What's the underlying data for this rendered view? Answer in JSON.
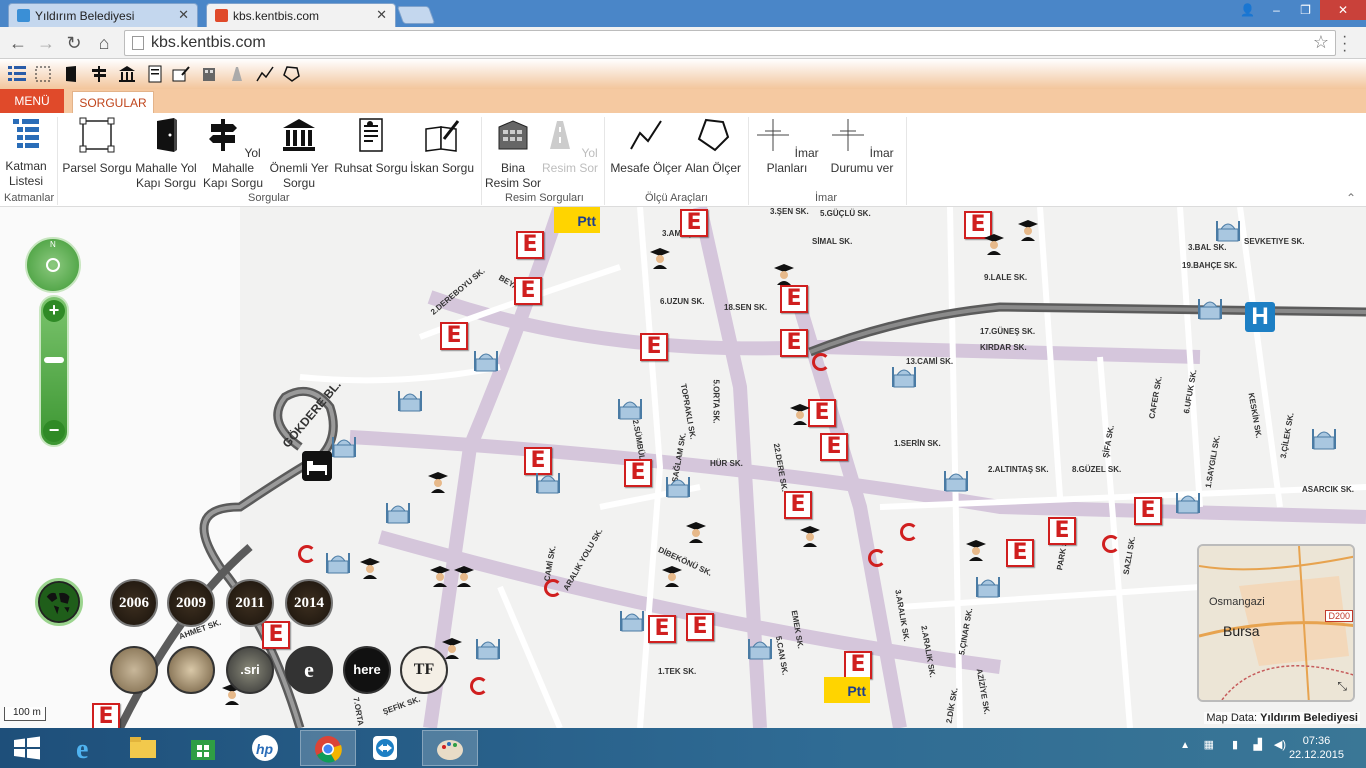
{
  "browser": {
    "tabs": [
      {
        "title": "Yıldırım Belediyesi",
        "active": false
      },
      {
        "title": "kbs.kentbis.com",
        "active": true
      }
    ],
    "url": "kbs.kentbis.com"
  },
  "menubar": {
    "menu_label": "MENÜ",
    "active_tab": "SORGULAR"
  },
  "ribbon": {
    "groups": [
      {
        "label": "Katmanlar",
        "buttons": [
          {
            "label": "Katman Listesi",
            "icon": "layers-list-icon",
            "enabled": true
          }
        ]
      },
      {
        "label": "Sorgular",
        "buttons": [
          {
            "label": "Parsel Sorgu",
            "icon": "parcel-icon",
            "enabled": true
          },
          {
            "label": "Mahalle Yol Kapı Sorgu",
            "icon": "door-icon",
            "enabled": true
          },
          {
            "label": "Yol Mahalle Kapı Sorgu",
            "icon": "signpost-icon",
            "enabled": true
          },
          {
            "label": "Önemli Yer Sorgu",
            "icon": "landmark-icon",
            "enabled": true
          },
          {
            "label": "Ruhsat Sorgu",
            "icon": "license-doc-icon",
            "enabled": true
          },
          {
            "label": "İskan Sorgu",
            "icon": "book-pen-icon",
            "enabled": true
          }
        ]
      },
      {
        "label": "Resim Sorguları",
        "buttons": [
          {
            "label": "Bina Resim Sor",
            "icon": "building-photo-icon",
            "enabled": true
          },
          {
            "label": "Yol Resim Sor",
            "icon": "road-photo-icon",
            "enabled": false
          }
        ]
      },
      {
        "label": "Ölçü Araçları",
        "buttons": [
          {
            "label": "Mesafe Ölçer",
            "icon": "distance-measure-icon",
            "enabled": true
          },
          {
            "label": "Alan Ölçer",
            "icon": "area-measure-icon",
            "enabled": true
          }
        ]
      },
      {
        "label": "İmar",
        "buttons": [
          {
            "label": "İmar Planları",
            "icon": "zoning-plan-icon",
            "enabled": true
          },
          {
            "label": "İmar Durumu ver",
            "icon": "zoning-status-icon",
            "enabled": true
          }
        ]
      }
    ]
  },
  "map": {
    "streets": [
      "3.ŞEN SK.",
      "5.GÜÇLÜ SK.",
      "SİMAL SK.",
      "3.AMAÇ SK.",
      "2.DEREBOYU SK.",
      "BEYAZIT CD.",
      "6.UZUN SK.",
      "18.SEN SK.",
      "3.BAL SK.",
      "SEVKETIYE SK.",
      "19.BAHÇE SK.",
      "9.LALE SK.",
      "17.GÜNEŞ SK.",
      "KIRDAR SK.",
      "13.CAMİ SK.",
      "GÖKDERE BL.",
      "TOPRAKLI SK.",
      "5.ORTA SK.",
      "2.SÜMBÜL SK.",
      "SAĞLAM SK.",
      "HÜR SK.",
      "22.DERE SK.",
      "1.SERİN SK.",
      "2.ALTINTAŞ SK.",
      "8.GÜZEL SK.",
      "ASARCIK SK.",
      "CAFER SK.",
      "6.UFUK SK.",
      "KESKİN SK.",
      "3.ÇİLEK SK.",
      "ŞİFA SK.",
      "1.SAYGILI SK.",
      "DİBEKÖNÜ SK.",
      "ARALIK YOLU SK.",
      "CAMİ SK.",
      "PARK SK.",
      "SAZLI SK.",
      "3.ARALIK SK.",
      "2.ARALIK SK.",
      "5.ÇINAR SK.",
      "EMEK SK.",
      "5.CAN SK.",
      "1.TEK SK.",
      "2.DİK SK.",
      "AZİZİYE SK.",
      "AHMET SK.",
      "ŞEFİK SK.",
      "7.ORTA"
    ],
    "year_buttons": [
      "2006",
      "2009",
      "2011",
      "2014"
    ],
    "layer_buttons": [
      "here",
      ".sri"
    ],
    "compass_north": "N",
    "minimap": {
      "city": "Bursa",
      "district": "Osmangazi",
      "road": "D200"
    },
    "scale_label": "100 m",
    "attribution_prefix": "Map Data:",
    "attribution_owner": "Yıldırım Belediyesi",
    "marker_labels": {
      "education": "E",
      "hospital": "H",
      "post": "Ptt"
    }
  },
  "taskbar": {
    "time": "07:36",
    "date": "22.12.2015"
  },
  "colors": {
    "accent": "#e04a2a",
    "ribbon_bg": "#f5c9a1",
    "taskbar": "#1e4f7a",
    "education_marker": "#d01f1f",
    "hospital": "#1d7fc4",
    "map_bg": "#f2f2f1"
  }
}
